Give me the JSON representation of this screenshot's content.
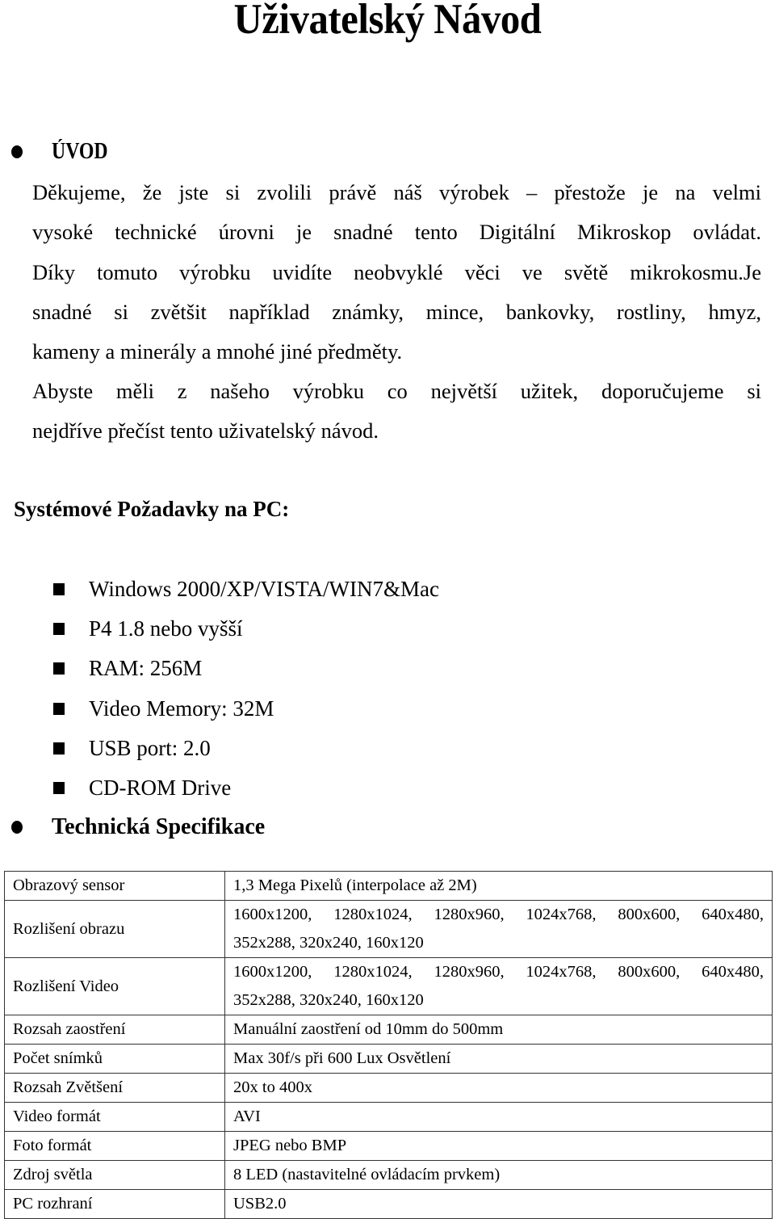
{
  "title": "Uživatelský Návod",
  "intro": {
    "heading": "ÚVOD",
    "lines": [
      "Děkujeme, že jste si zvolili právě náš výrobek – přestože je na velmi",
      "vysoké technické úrovni je snadné tento Digitální Mikroskop ovládat.",
      "Díky tomuto výrobku uvidíte neobvyklé věci ve světě mikrokosmu.Je",
      "snadné si zvětšit například známky, mince, bankovky, rostliny, hmyz,",
      "kameny a minerály a mnohé jiné předměty."
    ],
    "lines2": [
      "Abyste měli z našeho výrobku co největší užitek, doporučujeme si",
      "nejdříve přečíst tento uživatelský návod."
    ]
  },
  "requirements": {
    "heading": "Systémové Požadavky na PC:",
    "items": [
      "Windows 2000/XP/VISTA/WIN7&Mac",
      "P4 1.8 nebo vyšší",
      "RAM: 256M",
      "Video Memory: 32M",
      "USB port: 2.0",
      "CD-ROM Drive"
    ]
  },
  "spec": {
    "heading": "Technická Specifikace",
    "rows": [
      {
        "key": "Obrazový sensor",
        "value": [
          "1,3 Mega Pixelů  (interpolace až 2M)"
        ]
      },
      {
        "key": "Rozlišení obrazu",
        "value": [
          "1600x1200,  1280x1024,  1280x960,  1024x768,  800x600,  640x480,",
          "352x288, 320x240, 160x120"
        ]
      },
      {
        "key": "Rozlišení Video",
        "value": [
          "1600x1200,  1280x1024,  1280x960,  1024x768,  800x600,  640x480,",
          "352x288, 320x240, 160x120"
        ]
      },
      {
        "key": "Rozsah zaostření",
        "value": [
          "Manuální zaostření od 10mm do 500mm"
        ]
      },
      {
        "key": "Počet snímků",
        "value": [
          "Max 30f/s při 600 Lux Osvětlení"
        ]
      },
      {
        "key": "Rozsah Zvětšení",
        "value": [
          "20x to 400x"
        ]
      },
      {
        "key": "Video formát",
        "value": [
          "AVI"
        ]
      },
      {
        "key": "Foto formát",
        "value": [
          "JPEG nebo BMP"
        ]
      },
      {
        "key": "Zdroj světla",
        "value": [
          "8 LED (nastavitelné ovládacím prvkem)"
        ]
      },
      {
        "key": "PC rozhraní",
        "value": [
          "USB2.0"
        ]
      }
    ]
  },
  "icons": {
    "heading_bullet": "filled-circle-bullet",
    "list_bullet": "filled-square-bullet"
  }
}
